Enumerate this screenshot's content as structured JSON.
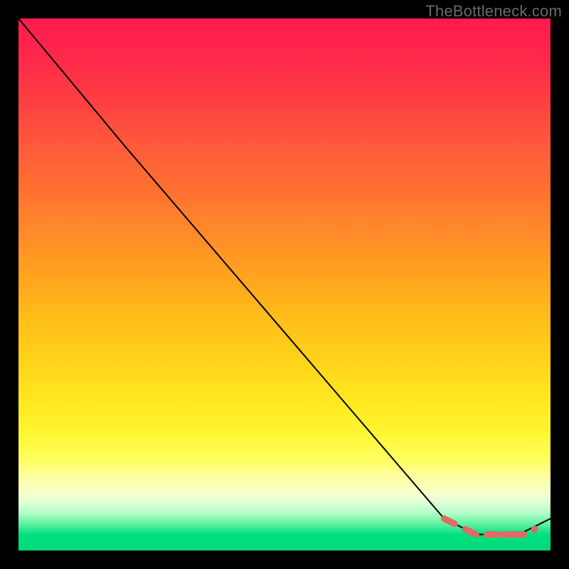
{
  "watermark": "TheBottleneck.com",
  "chart_data": {
    "type": "line",
    "title": "",
    "xlabel": "",
    "ylabel": "",
    "xlim": [
      0,
      100
    ],
    "ylim": [
      0,
      100
    ],
    "series": [
      {
        "name": "curve",
        "x": [
          0,
          20,
          80,
          86,
          94,
          100
        ],
        "values": [
          100,
          76,
          6,
          3,
          3,
          6
        ]
      }
    ],
    "highlight": {
      "segments": [
        {
          "x0": 80,
          "y0": 6,
          "x1": 82,
          "y1": 5
        },
        {
          "x0": 84,
          "y0": 4,
          "x1": 86,
          "y1": 3
        },
        {
          "x0": 88,
          "y0": 3,
          "x1": 90,
          "y1": 3
        },
        {
          "x0": 91,
          "y0": 3,
          "x1": 95,
          "y1": 3
        }
      ],
      "end_dot": {
        "x": 97,
        "y": 4
      }
    },
    "colors": {
      "curve": "#000000",
      "highlight": "#e06a66"
    }
  }
}
